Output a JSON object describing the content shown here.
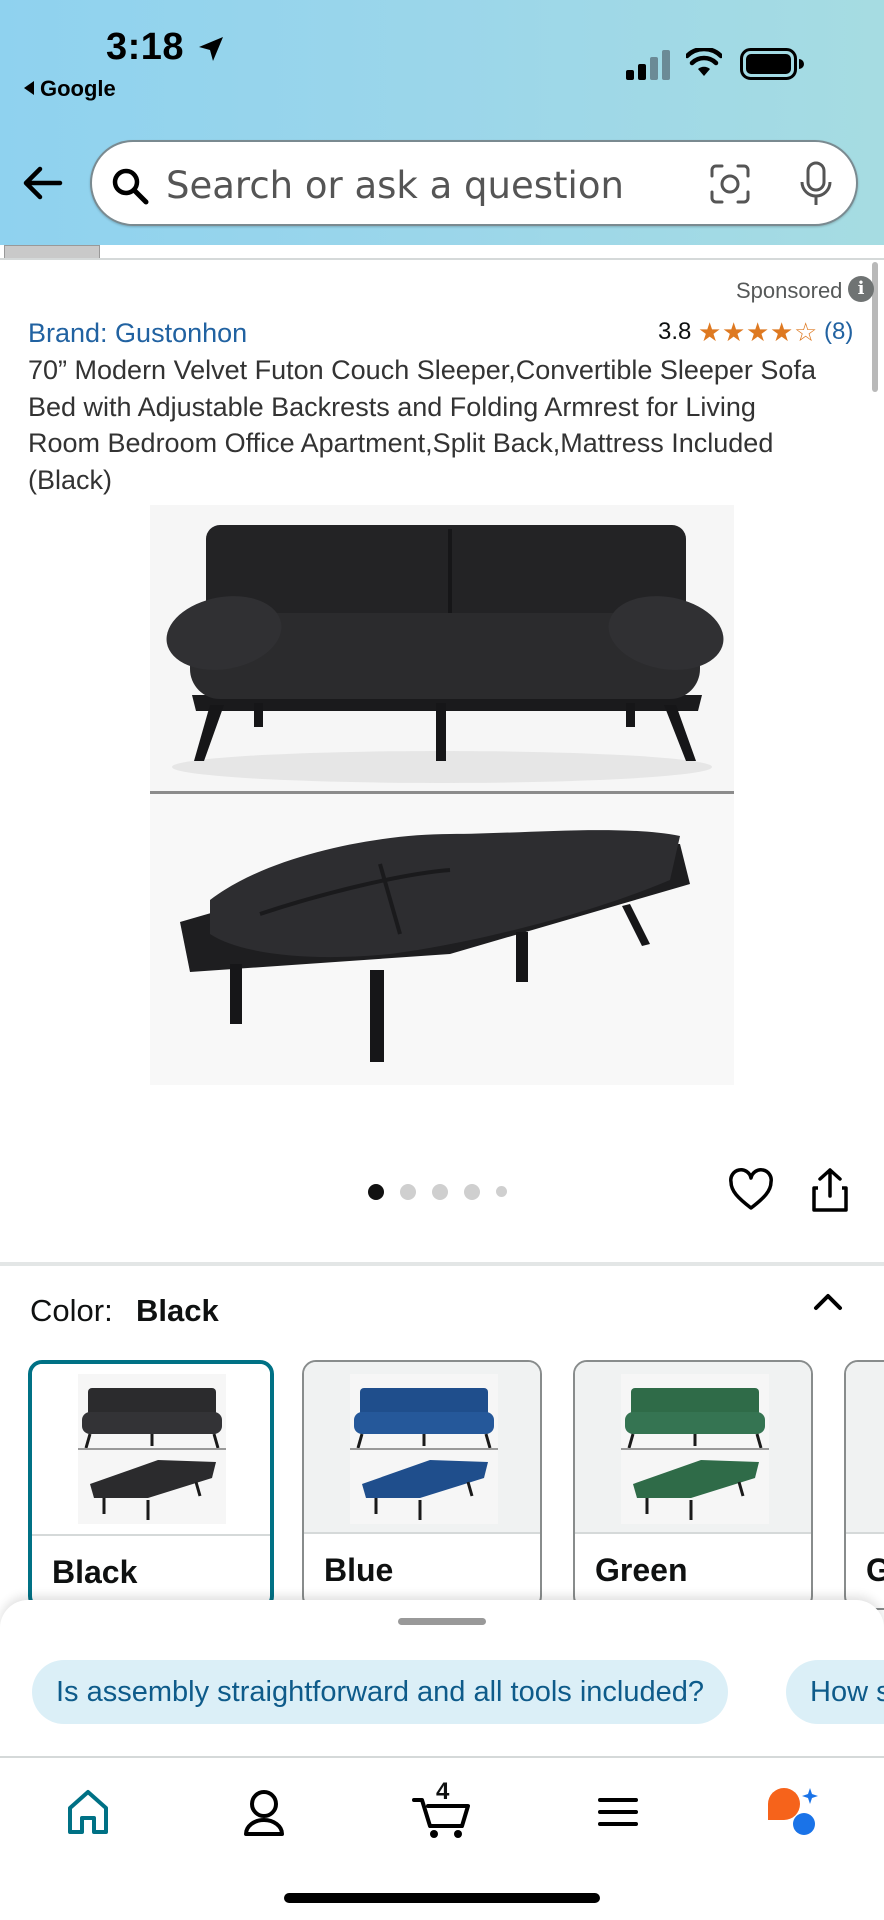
{
  "status_bar": {
    "time": "3:18",
    "back_app": "Google"
  },
  "header": {
    "search_placeholder": "Search or ask a question"
  },
  "product": {
    "sponsored": "Sponsored",
    "brand": "Brand: Gustonhon",
    "rating": "3.8",
    "rating_value": 3.8,
    "review_count": "(8)",
    "title": "70” Modern Velvet Futon Couch Sleeper,Convertible Sleeper Sofa Bed with Adjustable Backrests and Folding Armrest for Living Room Bedroom Office Apartment,Split Back,Mattress Included (Black)",
    "image_count": 5,
    "active_image": 1
  },
  "color": {
    "label": "Color:",
    "selected": "Black",
    "options": [
      {
        "name": "Black",
        "color": "#2b2b2d"
      },
      {
        "name": "Blue",
        "color": "#1f4e8c"
      },
      {
        "name": "Green",
        "color": "#2f6b48"
      },
      {
        "name": "G",
        "color": "#777777"
      }
    ]
  },
  "suggestions": [
    "Is assembly straightforward and all tools included?",
    "How s"
  ],
  "tabbar": {
    "cart_count": "4",
    "items": [
      "home-icon",
      "account-icon",
      "cart-icon",
      "menu-icon",
      "rufus-icon"
    ]
  },
  "colors": {
    "accent_teal": "#007185",
    "link_blue": "#2162a1",
    "star_orange": "#de7921"
  }
}
